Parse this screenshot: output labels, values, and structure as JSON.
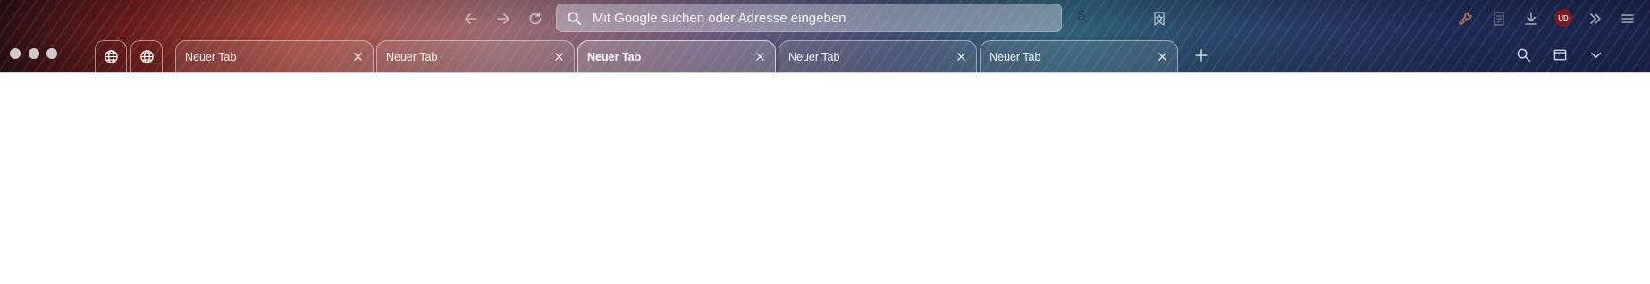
{
  "toolbar": {
    "back_icon": "arrow-left-icon",
    "forward_icon": "arrow-right-icon",
    "reload_icon": "reload-icon",
    "bookmark_icon": "bookmark-star-icon",
    "tools_icon": "wrench-icon",
    "reader_icon": "document-icon",
    "downloads_icon": "download-icon",
    "ublock_badge": "UD",
    "extensions_icon": "double-chevron-icon",
    "menu_icon": "hamburger-menu-icon",
    "faint_extension_letter": "S"
  },
  "urlbar": {
    "placeholder": "Mit Google suchen oder Adresse eingeben",
    "value": ""
  },
  "tabstrip": {
    "pinned": [
      {
        "icon": "globe-icon"
      },
      {
        "icon": "globe-icon"
      }
    ],
    "tabs": [
      {
        "label": "Neuer Tab",
        "active": false
      },
      {
        "label": "Neuer Tab",
        "active": false
      },
      {
        "label": "Neuer Tab",
        "active": true
      },
      {
        "label": "Neuer Tab",
        "active": false
      },
      {
        "label": "Neuer Tab",
        "active": false
      }
    ],
    "right_icons": [
      "search-icon",
      "window-icon",
      "chevron-down-icon"
    ]
  },
  "colors": {
    "chrome_left": "#6b1c1c",
    "chrome_mid": "#3c4d72",
    "chrome_right": "#1a2249",
    "content_bg": "#ffffff"
  }
}
